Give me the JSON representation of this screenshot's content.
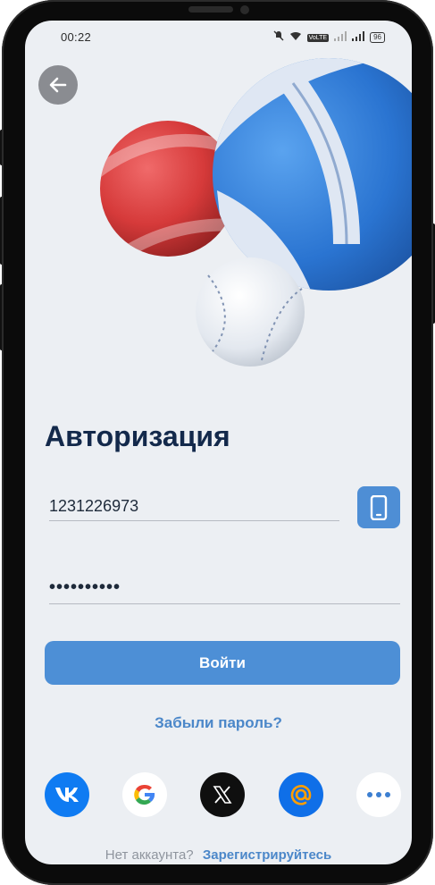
{
  "status_bar": {
    "time": "00:22",
    "icons": [
      "mute-icon",
      "wifi-icon",
      "volte-icon",
      "signal-icon",
      "signal-icon",
      "battery-icon"
    ],
    "volte_label": "VoLTE",
    "battery_label": "96"
  },
  "auth": {
    "title": "Авторизация",
    "phone_value": "1231226973",
    "password_value": "••••••••••",
    "login_label": "Войти",
    "forgot_label": "Забыли пароль?",
    "no_account_label": "Нет аккаунта?",
    "register_label": "Зарегистрируйтесь"
  },
  "social": {
    "items": [
      "vk-icon",
      "google-icon",
      "x-icon",
      "mail-at-icon",
      "more-icon"
    ]
  },
  "colors": {
    "accent": "#4d8fd6",
    "title": "#13294b",
    "background": "#eceff3"
  }
}
